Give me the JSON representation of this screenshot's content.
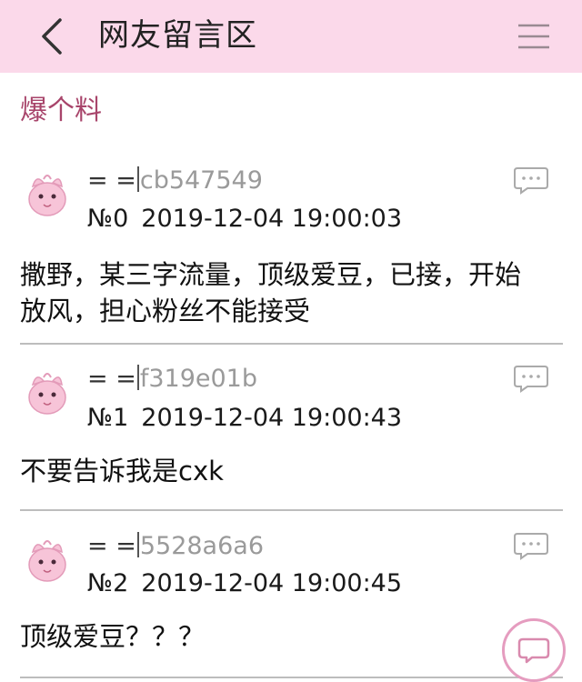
{
  "header": {
    "title": "网友留言区",
    "back_icon": "chevron-left-icon",
    "menu_icon": "hamburger-menu-icon",
    "background_color": "#fbd9ea"
  },
  "section": {
    "title": "爆个料",
    "color": "#a8456b"
  },
  "comments": [
    {
      "user_prefix": "= =",
      "user_id": "cb547549",
      "floor": "№0",
      "timestamp": "2019-12-04 19:00:03",
      "text_lines": [
        "撒野，某三字流量，顶级爱豆，已接，开始",
        "放风，担心粉丝不能接受"
      ]
    },
    {
      "user_prefix": "= =",
      "user_id": "f319e01b",
      "floor": "№1",
      "timestamp": "2019-12-04 19:00:43",
      "text_lines": [
        "不要告诉我是cxk"
      ]
    },
    {
      "user_prefix": "= =",
      "user_id": "5528a6a6",
      "floor": "№2",
      "timestamp": "2019-12-04 19:00:45",
      "text_lines": [
        "顶级爱豆？？？"
      ]
    }
  ],
  "floating_button": {
    "icon": "chat-bubble-icon",
    "border_color": "#e59cbf"
  }
}
